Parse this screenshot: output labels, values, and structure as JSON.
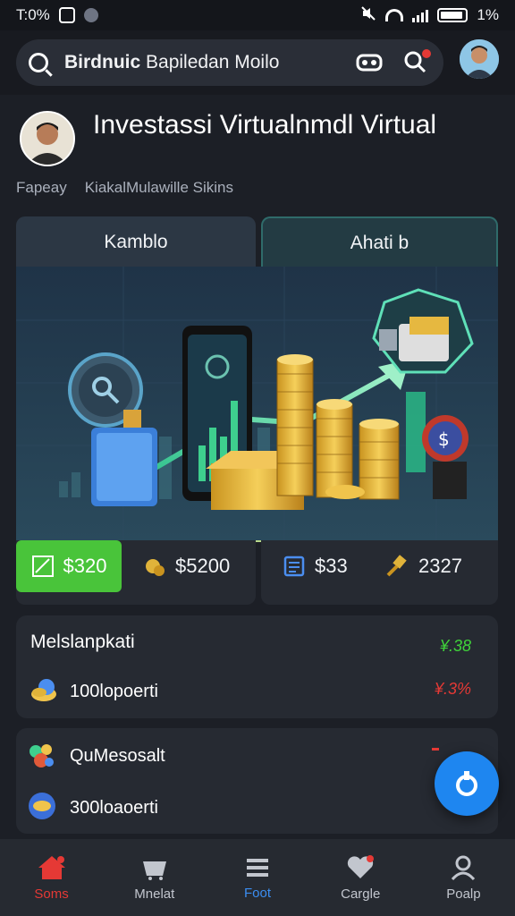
{
  "status_bar": {
    "time": "T:0%",
    "battery": "1%"
  },
  "search": {
    "text_bold": "Birdnuic",
    "text_rest": " Bapiledan Moilo"
  },
  "profile": {
    "title": "Investassi Virtualnmdl Virtual",
    "sub_left": "Fapeay",
    "sub_right": "KiakalMulawille Sikins"
  },
  "tabs": [
    {
      "label": "Kamblo"
    },
    {
      "label": "Ahati b"
    }
  ],
  "stats": [
    {
      "label": "$320",
      "icon": "chart-icon",
      "color": "#49c43a"
    },
    {
      "label": "$5200",
      "icon": "coin-bag-icon"
    },
    {
      "label": "$33",
      "icon": "ledger-icon"
    },
    {
      "label": "2327",
      "icon": "gavel-icon"
    }
  ],
  "cards": [
    {
      "title": "Melslanpkati",
      "change_up": "¥.38",
      "row_text": "100lopoerti",
      "change_down": "¥.3%"
    },
    {
      "title": "QuMesosalt",
      "row_text": "300loaoerti"
    }
  ],
  "bottom_nav": [
    {
      "label": "Soms",
      "icon": "home-icon"
    },
    {
      "label": "Mnelat",
      "icon": "cart-icon"
    },
    {
      "label": "Foot",
      "icon": "menu-icon"
    },
    {
      "label": "Cargle",
      "icon": "heart-icon"
    },
    {
      "label": "Poalp",
      "icon": "profile-icon"
    }
  ],
  "colors": {
    "background": "#1c1f26",
    "accent_green": "#49c43a",
    "accent_red": "#e53935",
    "accent_blue": "#1e86f0"
  }
}
